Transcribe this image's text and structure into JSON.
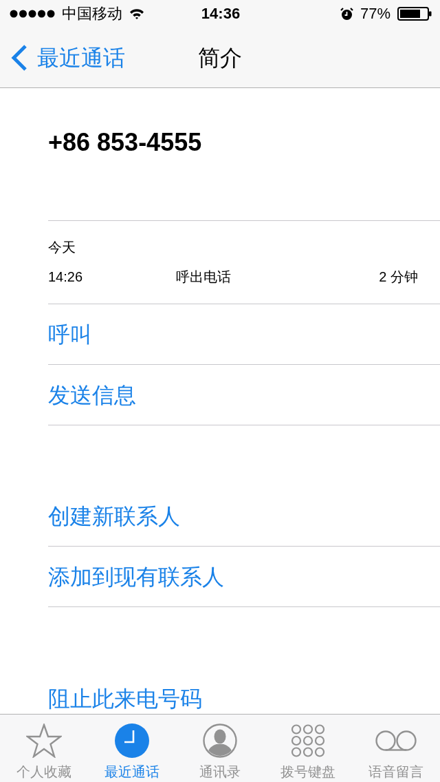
{
  "status_bar": {
    "carrier": "中国移动",
    "time": "14:36",
    "battery": "77%"
  },
  "nav_bar": {
    "back": "最近通话",
    "title": "简介"
  },
  "contact": {
    "number": "+86 853-4555"
  },
  "call_log": {
    "date": "今天",
    "calls": [
      {
        "time": "14:26",
        "type": "呼出电话",
        "duration": "2 分钟"
      }
    ]
  },
  "action_groups": [
    {
      "actions": [
        "呼叫",
        "发送信息"
      ]
    },
    {
      "actions": [
        "创建新联系人",
        "添加到现有联系人"
      ]
    },
    {
      "actions": [
        "阻止此来电号码"
      ]
    }
  ],
  "tab_bar": [
    {
      "label": "个人收藏",
      "selected": false
    },
    {
      "label": "最近通话",
      "selected": true
    },
    {
      "label": "通讯录",
      "selected": false
    },
    {
      "label": "拨号键盘",
      "selected": false
    },
    {
      "label": "语音留言",
      "selected": false
    }
  ]
}
